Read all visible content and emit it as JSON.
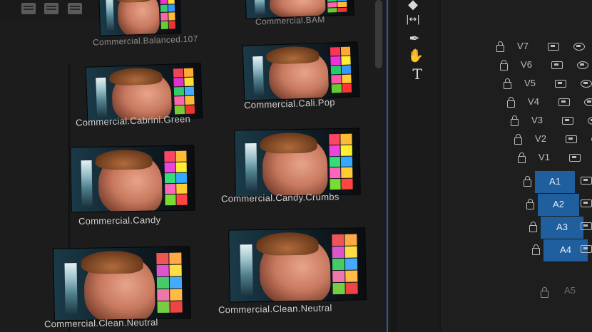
{
  "lut_browser": {
    "items": [
      {
        "label": "Commercial.Balanced.107",
        "chart": [
          "#e34",
          "#f93",
          "#e3c",
          "#fd3",
          "#3c6",
          "#39f",
          "#f6a",
          "#fb3",
          "#6c3",
          "#e33"
        ]
      },
      {
        "label": "Commercial.BAM",
        "chart": [
          "#e34",
          "#fa3",
          "#e3c",
          "#fd3",
          "#3c6",
          "#39f",
          "#f6a",
          "#fb3",
          "#6c3",
          "#e33"
        ]
      },
      {
        "label": "Commercial.Cabrini.Green",
        "chart": [
          "#e45",
          "#fa3",
          "#d3c",
          "#fd3",
          "#3c6",
          "#4af",
          "#f6a",
          "#fb3",
          "#7c3",
          "#e33"
        ]
      },
      {
        "label": "Commercial.Cali.Pop",
        "chart": [
          "#f35",
          "#fa3",
          "#e3d",
          "#fe3",
          "#2c6",
          "#39f",
          "#f5a",
          "#fc3",
          "#6c3",
          "#f33"
        ]
      },
      {
        "label": "Commercial.Candy",
        "chart": [
          "#f46",
          "#fb3",
          "#e4d",
          "#fe3",
          "#3d7",
          "#3af",
          "#f6b",
          "#fc3",
          "#7d3",
          "#f44"
        ]
      },
      {
        "label": "Commercial.Candy.Crumbs",
        "chart": [
          "#f46",
          "#fb3",
          "#e4d",
          "#fe3",
          "#3d7",
          "#3af",
          "#f6b",
          "#fc3",
          "#7d3",
          "#f44"
        ]
      },
      {
        "label": "Commercial.Clean.Neutral",
        "chart": [
          "#e55",
          "#fa4",
          "#d5c",
          "#fd4",
          "#4c6",
          "#4af",
          "#e7a",
          "#fb4",
          "#7c4",
          "#e44"
        ]
      },
      {
        "label": "Commercial.Clean.Neutral",
        "chart": [
          "#e55",
          "#fa4",
          "#d5c",
          "#fd4",
          "#4c6",
          "#4af",
          "#e7a",
          "#fb4",
          "#7c4",
          "#e44"
        ]
      }
    ]
  },
  "tools": [
    {
      "name": "razor-tool-icon",
      "glyph": "◆"
    },
    {
      "name": "slip-tool-icon",
      "glyph": "|↔|"
    },
    {
      "name": "pen-tool-icon",
      "glyph": "✒"
    },
    {
      "name": "hand-tool-icon",
      "glyph": "✋"
    },
    {
      "name": "type-tool-icon",
      "glyph": "T"
    }
  ],
  "tracks": {
    "video": [
      "V7",
      "V6",
      "V5",
      "V4",
      "V3",
      "V2",
      "V1"
    ],
    "audio": [
      "A1",
      "A2",
      "A3",
      "A4",
      "A5"
    ]
  },
  "colors": {
    "accent_blue": "#3f6fb8",
    "audio_target": "#1f5f9e"
  }
}
